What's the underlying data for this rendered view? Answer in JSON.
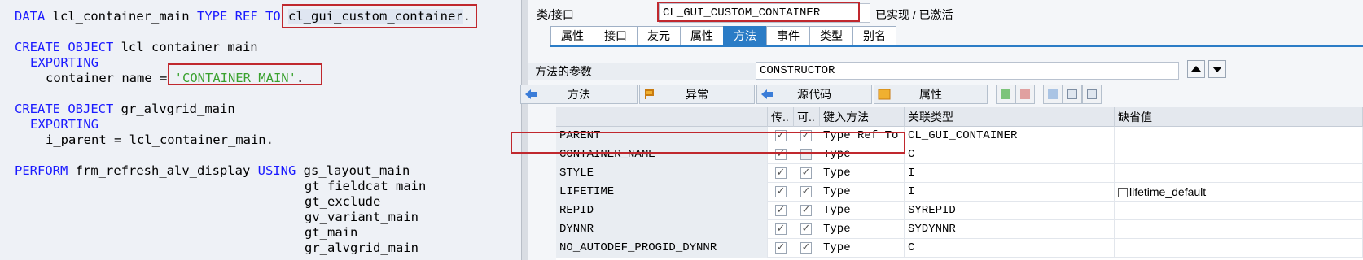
{
  "code": {
    "line1": {
      "kw1": "DATA",
      "var": "lcl_container_main",
      "kw2": "TYPE REF TO",
      "type": "cl_gui_custom_container",
      "end": "."
    },
    "line2": {
      "kw": "CREATE OBJECT",
      "var": "lcl_container_main"
    },
    "line3": {
      "kw": "EXPORTING"
    },
    "line4": {
      "param": "container_name =",
      "str": "'CONTAINER_MAIN'",
      "end": "."
    },
    "line5": {
      "kw": "CREATE OBJECT",
      "var": "gr_alvgrid_main"
    },
    "line6": {
      "kw": "EXPORTING"
    },
    "line7": {
      "text": "i_parent = lcl_container_main."
    },
    "line8": {
      "kw1": "PERFORM",
      "form": "frm_refresh_alv_display",
      "kw2": "USING",
      "arg": "gs_layout_main"
    },
    "args": [
      "gt_fieldcat_main",
      "gt_exclude",
      "gv_variant_main",
      "gt_main",
      "gr_alvgrid_main"
    ]
  },
  "sap": {
    "class_label": "类/接口",
    "class_value": "CL_GUI_CUSTOM_CONTAINER",
    "status": "已实现 / 已激活",
    "tabs": [
      "属性",
      "接口",
      "友元",
      "属性",
      "方法",
      "事件",
      "类型",
      "别名"
    ],
    "active_tab": 4,
    "params_label": "方法的参数",
    "method_value": "CONSTRUCTOR",
    "sub_buttons": {
      "methods": "方法",
      "exceptions": "异常",
      "source": "源代码",
      "attributes": "属性"
    },
    "grid": {
      "headers": {
        "name": "",
        "pass": "传..",
        "optional": "可..",
        "typing": "键入方法",
        "ref_type": "关联类型",
        "default": "缺省值"
      },
      "rows": [
        {
          "name": "PARENT",
          "pass": true,
          "optional": true,
          "typing": "Type Ref To",
          "ref_type": "CL_GUI_CONTAINER",
          "default": ""
        },
        {
          "name": "CONTAINER_NAME",
          "pass": true,
          "optional": false,
          "typing": "Type",
          "ref_type": "C",
          "default": ""
        },
        {
          "name": "STYLE",
          "pass": true,
          "optional": true,
          "typing": "Type",
          "ref_type": "I",
          "default": ""
        },
        {
          "name": "LIFETIME",
          "pass": true,
          "optional": true,
          "typing": "Type",
          "ref_type": "I",
          "default": "lifetime_default"
        },
        {
          "name": "REPID",
          "pass": true,
          "optional": true,
          "typing": "Type",
          "ref_type": "SYREPID",
          "default": ""
        },
        {
          "name": "DYNNR",
          "pass": true,
          "optional": true,
          "typing": "Type",
          "ref_type": "SYDYNNR",
          "default": ""
        },
        {
          "name": "NO_AUTODEF_PROGID_DYNNR",
          "pass": true,
          "optional": true,
          "typing": "Type",
          "ref_type": "C",
          "default": ""
        }
      ]
    }
  },
  "colors": {
    "highlight_box": "#c0282e",
    "keyword": "#1a1aff",
    "string": "#3aa12f",
    "active_tab": "#2b7cc6"
  }
}
